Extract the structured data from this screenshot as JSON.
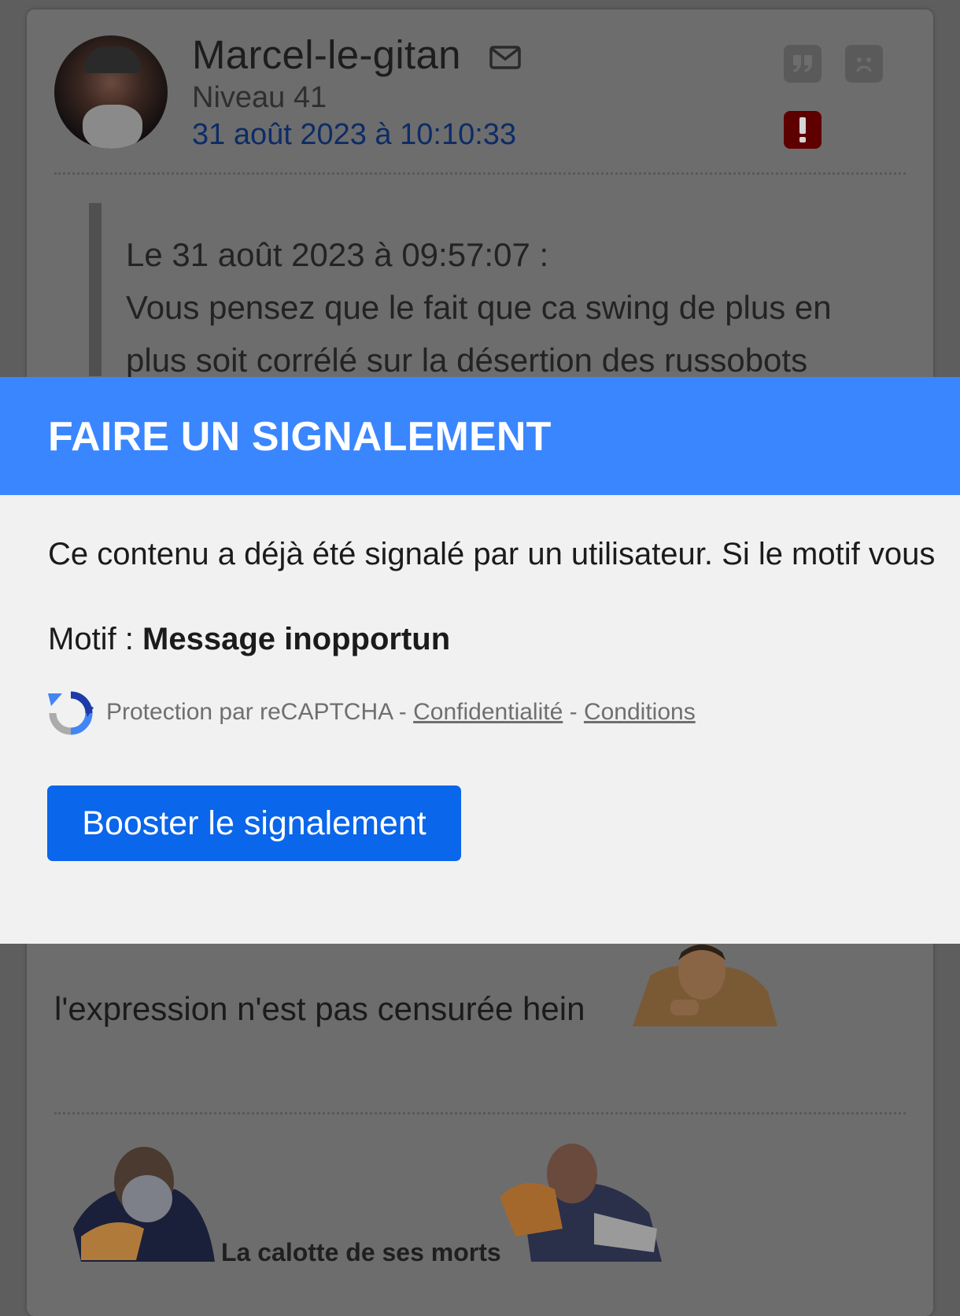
{
  "post": {
    "username": "Marcel-le-gitan",
    "level": "Niveau 41",
    "date": "31 août 2023 à 10:10:33",
    "quote_header": "Le 31 août 2023 à 09:57:07 :",
    "quote_body": "Vous pensez que le fait que ca swing de plus en plus soit corrélé sur la désertion des russobots",
    "body_text": "l'expression n'est pas censurée hein",
    "signature_text": "La calotte de ses morts",
    "icons": [
      "mail-icon",
      "quote-icon",
      "sad-face-icon",
      "report-icon"
    ]
  },
  "modal": {
    "title": "FAIRE UN SIGNALEMENT",
    "info": "Ce contenu a déjà été signalé par un utilisateur. Si le motif vous",
    "motif_label": "Motif : ",
    "motif_value": "Message inopportun",
    "recaptcha_prefix": "Protection par reCAPTCHA - ",
    "recaptcha_privacy": "Confidentialité",
    "recaptcha_sep": " - ",
    "recaptcha_terms": "Conditions",
    "boost_button": "Booster le signalement"
  },
  "colors": {
    "modal_header": "#3a86ff",
    "primary_button": "#0a66ea",
    "report_icon": "#c00000",
    "date_link": "#1a56c7"
  }
}
